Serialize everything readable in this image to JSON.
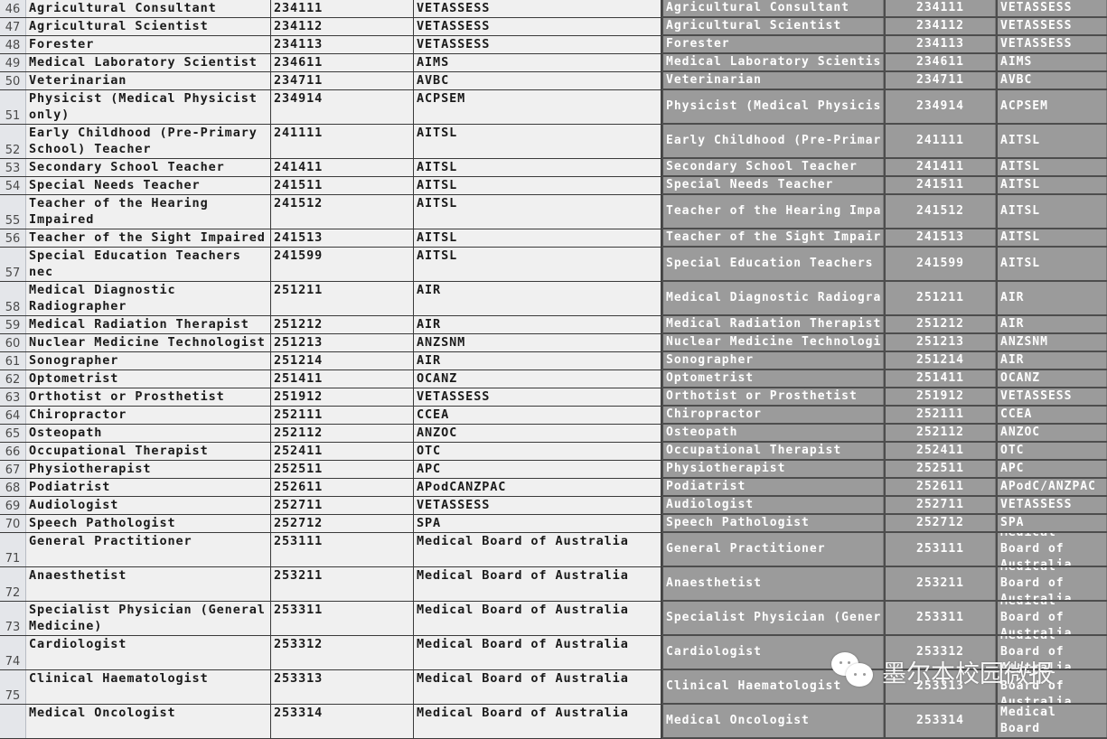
{
  "left_table": {
    "rows": [
      {
        "num": "46",
        "occupation": "Agricultural Consultant",
        "code": "234111",
        "authority": "VETASSESS",
        "lines": 1
      },
      {
        "num": "47",
        "occupation": "Agricultural Scientist",
        "code": "234112",
        "authority": "VETASSESS",
        "lines": 1
      },
      {
        "num": "48",
        "occupation": "Forester",
        "code": "234113",
        "authority": "VETASSESS",
        "lines": 1
      },
      {
        "num": "49",
        "occupation": "Medical Laboratory Scientist",
        "code": "234611",
        "authority": "AIMS",
        "lines": 1
      },
      {
        "num": "50",
        "occupation": "Veterinarian",
        "code": "234711",
        "authority": "AVBC",
        "lines": 1
      },
      {
        "num": "51",
        "occupation": "Physicist (Medical Physicist only)",
        "code": "234914",
        "authority": "ACPSEM",
        "lines": 2
      },
      {
        "num": "52",
        "occupation": "Early Childhood (Pre-Primary School) Teacher",
        "code": "241111",
        "authority": "AITSL",
        "lines": 2
      },
      {
        "num": "53",
        "occupation": "Secondary School Teacher",
        "code": "241411",
        "authority": "AITSL",
        "lines": 1
      },
      {
        "num": "54",
        "occupation": "Special Needs Teacher",
        "code": "241511",
        "authority": "AITSL",
        "lines": 1
      },
      {
        "num": "55",
        "occupation": "Teacher of the Hearing Impaired",
        "code": "241512",
        "authority": "AITSL",
        "lines": 2
      },
      {
        "num": "56",
        "occupation": "Teacher of the Sight Impaired",
        "code": "241513",
        "authority": "AITSL",
        "lines": 1
      },
      {
        "num": "57",
        "occupation": "Special Education Teachers nec",
        "code": "241599",
        "authority": "AITSL",
        "lines": 2
      },
      {
        "num": "58",
        "occupation": "Medical Diagnostic Radiographer",
        "code": "251211",
        "authority": "AIR",
        "lines": 2
      },
      {
        "num": "59",
        "occupation": "Medical Radiation Therapist",
        "code": "251212",
        "authority": "AIR",
        "lines": 1
      },
      {
        "num": "60",
        "occupation": "Nuclear Medicine Technologist",
        "code": "251213",
        "authority": "ANZSNM",
        "lines": 1
      },
      {
        "num": "61",
        "occupation": "Sonographer",
        "code": "251214",
        "authority": "AIR",
        "lines": 1
      },
      {
        "num": "62",
        "occupation": "Optometrist",
        "code": "251411",
        "authority": "OCANZ",
        "lines": 1
      },
      {
        "num": "63",
        "occupation": "Orthotist or Prosthetist",
        "code": "251912",
        "authority": "VETASSESS",
        "lines": 1
      },
      {
        "num": "64",
        "occupation": "Chiropractor",
        "code": "252111",
        "authority": "CCEA",
        "lines": 1
      },
      {
        "num": "65",
        "occupation": "Osteopath",
        "code": "252112",
        "authority": "ANZOC",
        "lines": 1
      },
      {
        "num": "66",
        "occupation": "Occupational Therapist",
        "code": "252411",
        "authority": "OTC",
        "lines": 1
      },
      {
        "num": "67",
        "occupation": "Physiotherapist",
        "code": "252511",
        "authority": "APC",
        "lines": 1
      },
      {
        "num": "68",
        "occupation": "Podiatrist",
        "code": "252611",
        "authority": "APodCANZPAC",
        "lines": 1
      },
      {
        "num": "69",
        "occupation": "Audiologist",
        "code": "252711",
        "authority": "VETASSESS",
        "lines": 1
      },
      {
        "num": "70",
        "occupation": "Speech Pathologist",
        "code": "252712",
        "authority": "SPA",
        "lines": 1
      },
      {
        "num": "71",
        "occupation": "General Practitioner",
        "code": "253111",
        "authority": "Medical Board of Australia",
        "lines": 2
      },
      {
        "num": "72",
        "occupation": "Anaesthetist",
        "code": "253211",
        "authority": "Medical Board of Australia",
        "lines": 2
      },
      {
        "num": "73",
        "occupation": "Specialist Physician (General Medicine)",
        "code": "253311",
        "authority": "Medical Board of Australia",
        "lines": 2
      },
      {
        "num": "74",
        "occupation": "Cardiologist",
        "code": "253312",
        "authority": "Medical Board of Australia",
        "lines": 2
      },
      {
        "num": "75",
        "occupation": "Clinical Haematologist",
        "code": "253313",
        "authority": "Medical Board of Australia",
        "lines": 2
      },
      {
        "num": "",
        "occupation": "Medical Oncologist",
        "code": "253314",
        "authority": "Medical Board of Australia",
        "lines": 2
      }
    ]
  },
  "right_table": {
    "rows": [
      {
        "occupation": "Agricultural Consultant",
        "code": "234111",
        "authority": "VETASSESS",
        "lines": 1
      },
      {
        "occupation": "Agricultural Scientist",
        "code": "234112",
        "authority": "VETASSESS",
        "lines": 1
      },
      {
        "occupation": "Forester",
        "code": "234113",
        "authority": "VETASSESS",
        "lines": 1
      },
      {
        "occupation": "Medical Laboratory Scientis",
        "code": "234611",
        "authority": "AIMS",
        "lines": 1
      },
      {
        "occupation": "Veterinarian",
        "code": "234711",
        "authority": "AVBC",
        "lines": 1
      },
      {
        "occupation": "Physicist (Medical Physicis",
        "code": "234914",
        "authority": "ACPSEM",
        "lines": 2
      },
      {
        "occupation": "Early Childhood (Pre-Primar",
        "code": "241111",
        "authority": "AITSL",
        "lines": 2
      },
      {
        "occupation": "Secondary School Teacher",
        "code": "241411",
        "authority": "AITSL",
        "lines": 1
      },
      {
        "occupation": "Special Needs Teacher",
        "code": "241511",
        "authority": "AITSL",
        "lines": 1
      },
      {
        "occupation": "Teacher of the Hearing Impa",
        "code": "241512",
        "authority": "AITSL",
        "lines": 2
      },
      {
        "occupation": "Teacher of the Sight Impair",
        "code": "241513",
        "authority": "AITSL",
        "lines": 1
      },
      {
        "occupation": "Special Education Teachers",
        "code": "241599",
        "authority": "AITSL",
        "lines": 2
      },
      {
        "occupation": "Medical Diagnostic Radiogra",
        "code": "251211",
        "authority": "AIR",
        "lines": 2
      },
      {
        "occupation": "Medical Radiation Therapist",
        "code": "251212",
        "authority": "AIR",
        "lines": 1
      },
      {
        "occupation": "Nuclear Medicine Technologi",
        "code": "251213",
        "authority": "ANZSNM",
        "lines": 1
      },
      {
        "occupation": "Sonographer",
        "code": "251214",
        "authority": "AIR",
        "lines": 1
      },
      {
        "occupation": "Optometrist",
        "code": "251411",
        "authority": "OCANZ",
        "lines": 1
      },
      {
        "occupation": "Orthotist or Prosthetist",
        "code": "251912",
        "authority": "VETASSESS",
        "lines": 1
      },
      {
        "occupation": "Chiropractor",
        "code": "252111",
        "authority": "CCEA",
        "lines": 1
      },
      {
        "occupation": "Osteopath",
        "code": "252112",
        "authority": "ANZOC",
        "lines": 1
      },
      {
        "occupation": "Occupational Therapist",
        "code": "252411",
        "authority": "OTC",
        "lines": 1
      },
      {
        "occupation": "Physiotherapist",
        "code": "252511",
        "authority": "APC",
        "lines": 1
      },
      {
        "occupation": "Podiatrist",
        "code": "252611",
        "authority": "APodC/ANZPAC",
        "lines": 1
      },
      {
        "occupation": "Audiologist",
        "code": "252711",
        "authority": "VETASSESS",
        "lines": 1
      },
      {
        "occupation": "Speech Pathologist",
        "code": "252712",
        "authority": "SPA",
        "lines": 1
      },
      {
        "occupation": "General Practitioner",
        "code": "253111",
        "authority": "Medical Board of Australia",
        "lines": 2
      },
      {
        "occupation": "Anaesthetist",
        "code": "253211",
        "authority": "Medical Board of Australia",
        "lines": 2
      },
      {
        "occupation": "Specialist Physician (Gener",
        "code": "253311",
        "authority": "Medical Board of Australia",
        "lines": 2
      },
      {
        "occupation": "Cardiologist",
        "code": "253312",
        "authority": "Medical Board of Australia",
        "lines": 2
      },
      {
        "occupation": "Clinical Haematologist",
        "code": "253313",
        "authority": "Medical Board of Australia",
        "lines": 2
      },
      {
        "occupation": "Medical Oncologist",
        "code": "253314",
        "authority": "Medical Board",
        "lines": 2
      }
    ]
  },
  "watermark": {
    "icon": "wechat-icon",
    "text": "墨尔本校园微报"
  },
  "colors": {
    "left_bg": "#f0f0f0",
    "right_cell_bg": "#9b9b9b",
    "right_text": "#ffffff",
    "grid": "#3a3a3a"
  }
}
